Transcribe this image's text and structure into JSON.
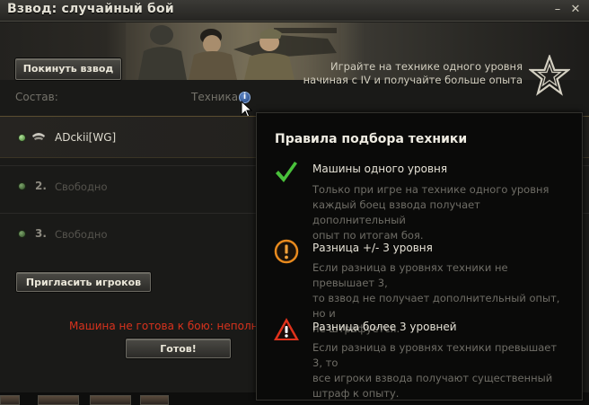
{
  "window": {
    "title": "Взвод: случайный бой",
    "minimize_glyph": "–",
    "close_glyph": "✕"
  },
  "banner": {
    "leave_button": "Покинуть взвод",
    "promo_line1": "Играйте на технике одного уровня",
    "promo_line2": "начиная с IV и получайте больше опыта",
    "star_icon": "star-emblem-icon"
  },
  "labels": {
    "composition": "Состав:",
    "vehicles": "Техника",
    "info_glyph": "i"
  },
  "members": [
    {
      "name": "ADckii[WG]",
      "status": "ready"
    },
    {
      "number": "2.",
      "name": "Свободно"
    },
    {
      "number": "3.",
      "name": "Свободно"
    }
  ],
  "actions": {
    "invite_button": "Пригласить игроков",
    "warning": "Машина не готова к бою: неполный эк",
    "ready_button": "Готов!"
  },
  "tooltip": {
    "title": "Правила подбора техники",
    "rules": [
      {
        "icon": "checkmark-icon",
        "heading": "Машины одного уровня",
        "lines": [
          "Только при игре на технике одного уровня",
          "каждый боец взвода получает дополнительный",
          "опыт по итогам боя."
        ]
      },
      {
        "icon": "exclamation-circle-icon",
        "heading": "Разница +/- 3 уровня",
        "lines": [
          "Если разница в уровнях техники не превышает 3,",
          "то взвод не получает дополнительный опыт, но и",
          "не штрафуется."
        ]
      },
      {
        "icon": "warning-triangle-icon",
        "heading": "Разница более 3 уровней",
        "lines": [
          "Если разница в уровнях техники превышает 3, то",
          "все игроки взвода получают существенный",
          "штраф к опыту."
        ]
      }
    ]
  },
  "colors": {
    "warning_red": "#d8321d",
    "check_green": "#49c13b",
    "caution_orange": "#e88a1e",
    "alert_red": "#e0321c"
  }
}
